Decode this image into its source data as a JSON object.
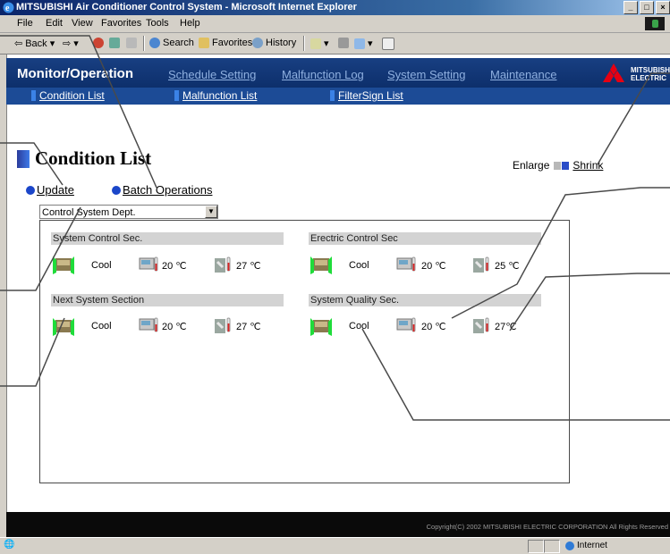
{
  "window": {
    "title": "MITSUBISHI Air Conditioner Control System - Microsoft Internet Explorer"
  },
  "menu": [
    "File",
    "Edit",
    "View",
    "Favorites",
    "Tools",
    "Help"
  ],
  "toolbar": {
    "back": "Back",
    "search": "Search",
    "favorites": "Favorites",
    "history": "History"
  },
  "header": {
    "title": "Monitor/Operation",
    "nav": [
      "Schedule Setting",
      "Malfunction Log",
      "System Setting",
      "Maintenance"
    ],
    "brand_line1": "MITSUBISHI",
    "brand_line2": "ELECTRIC",
    "subnav": [
      "Condition List",
      "Malfunction List",
      "FilterSign List"
    ]
  },
  "page": {
    "title": "Condition List",
    "enlarge": "Enlarge",
    "shrink": "Shrink",
    "update": "Update",
    "batch": "Batch Operations",
    "group_selected": "Control System Dept."
  },
  "groups": [
    {
      "name": "System Control Sec.",
      "mode": "Cool",
      "room_temp": "20 ℃",
      "set_temp": "27 ℃"
    },
    {
      "name": "Erectric Control Sec",
      "mode": "Cool",
      "room_temp": "20 ℃",
      "set_temp": "25 ℃"
    },
    {
      "name": "Next System Section",
      "mode": "Cool",
      "room_temp": "20 ℃",
      "set_temp": "27 ℃"
    },
    {
      "name": "System Quality Sec.",
      "mode": "Cool",
      "room_temp": "20 ℃",
      "set_temp": "27℃"
    }
  ],
  "footer": {
    "copyright": "Copyright(C) 2002 MITSUBISHI ELECTRIC CORPORATION All Rights Reserved"
  },
  "status": {
    "zone": "Internet"
  },
  "colors": {
    "header_bg": "#0f3572",
    "subnav_bg": "#1c4b96",
    "bullet": "#1b46c9",
    "section_head": "#d3d3d3"
  }
}
